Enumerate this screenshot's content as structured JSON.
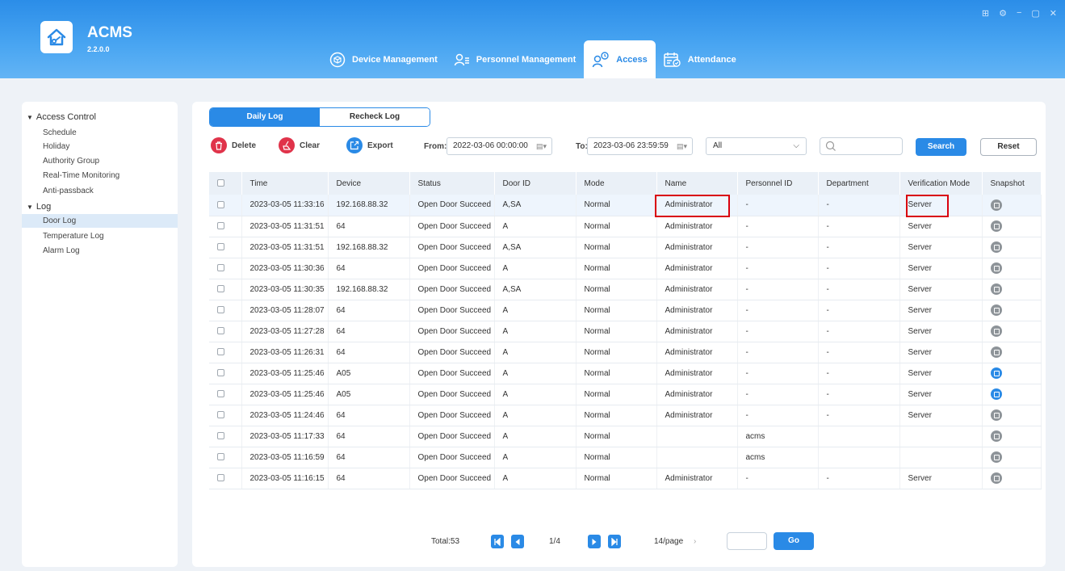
{
  "app": {
    "title": "ACMS",
    "version": "2.2.0.0"
  },
  "window_controls": [
    "⊞",
    "⚙",
    "−",
    "▢",
    "✕"
  ],
  "nav": [
    {
      "label": "Device Management",
      "icon": "device-icon"
    },
    {
      "label": "Personnel Management",
      "icon": "personnel-icon"
    },
    {
      "label": "Access",
      "icon": "access-icon",
      "active": true
    },
    {
      "label": "Attendance",
      "icon": "attendance-icon"
    }
  ],
  "sidebar": {
    "groups": [
      {
        "label": "Access Control",
        "children": [
          "Schedule",
          "Holiday",
          "Authority Group",
          "Real-Time Monitoring",
          "Anti-passback"
        ]
      },
      {
        "label": "Log",
        "children": [
          "Door Log",
          "Temperature Log",
          "Alarm Log"
        ]
      }
    ],
    "active": "Door Log"
  },
  "tabs": {
    "daily": "Daily Log",
    "recheck": "Recheck Log"
  },
  "toolbar": {
    "delete": "Delete",
    "clear": "Clear",
    "export": "Export",
    "from_label": "From:",
    "from_value": "2022-03-06 00:00:00",
    "to_label": "To:",
    "to_value": "2023-03-06 23:59:59",
    "filter_value": "All",
    "search_value": "",
    "search": "Search",
    "reset": "Reset"
  },
  "table": {
    "headers": [
      "Time",
      "Device",
      "Status",
      "Door ID",
      "Mode",
      "Name",
      "Personnel ID",
      "Department",
      "Verification Mode",
      "Snapshot"
    ],
    "rows": [
      [
        "2023-03-05 11:33:16",
        "192.168.88.32",
        "Open Door Succeed",
        "A,SA",
        "Normal",
        "Administrator",
        "-",
        "-",
        "Server",
        "gray"
      ],
      [
        "2023-03-05 11:31:51",
        "64",
        "Open Door Succeed",
        "A",
        "Normal",
        "Administrator",
        "-",
        "-",
        "Server",
        "gray"
      ],
      [
        "2023-03-05 11:31:51",
        "192.168.88.32",
        "Open Door Succeed",
        "A,SA",
        "Normal",
        "Administrator",
        "-",
        "-",
        "Server",
        "gray"
      ],
      [
        "2023-03-05 11:30:36",
        "64",
        "Open Door Succeed",
        "A",
        "Normal",
        "Administrator",
        "-",
        "-",
        "Server",
        "gray"
      ],
      [
        "2023-03-05 11:30:35",
        "192.168.88.32",
        "Open Door Succeed",
        "A,SA",
        "Normal",
        "Administrator",
        "-",
        "-",
        "Server",
        "gray"
      ],
      [
        "2023-03-05 11:28:07",
        "64",
        "Open Door Succeed",
        "A",
        "Normal",
        "Administrator",
        "-",
        "-",
        "Server",
        "gray"
      ],
      [
        "2023-03-05 11:27:28",
        "64",
        "Open Door Succeed",
        "A",
        "Normal",
        "Administrator",
        "-",
        "-",
        "Server",
        "gray"
      ],
      [
        "2023-03-05 11:26:31",
        "64",
        "Open Door Succeed",
        "A",
        "Normal",
        "Administrator",
        "-",
        "-",
        "Server",
        "gray"
      ],
      [
        "2023-03-05 11:25:46",
        "A05",
        "Open Door Succeed",
        "A",
        "Normal",
        "Administrator",
        "-",
        "-",
        "Server",
        "blue"
      ],
      [
        "2023-03-05 11:25:46",
        "A05",
        "Open Door Succeed",
        "A",
        "Normal",
        "Administrator",
        "-",
        "-",
        "Server",
        "blue"
      ],
      [
        "2023-03-05 11:24:46",
        "64",
        "Open Door Succeed",
        "A",
        "Normal",
        "Administrator",
        "-",
        "-",
        "Server",
        "gray"
      ],
      [
        "2023-03-05 11:17:33",
        "64",
        "Open Door Succeed",
        "A",
        "Normal",
        "",
        "acms",
        "",
        "",
        "gray"
      ],
      [
        "2023-03-05 11:16:59",
        "64",
        "Open Door Succeed",
        "A",
        "Normal",
        "",
        "acms",
        "",
        "",
        "gray"
      ],
      [
        "2023-03-05 11:16:15",
        "64",
        "Open Door Succeed",
        "A",
        "Normal",
        "Administrator",
        "-",
        "-",
        "Server",
        "gray"
      ]
    ]
  },
  "pagination": {
    "total": "Total:53",
    "page": "1/4",
    "per_page": "14/page",
    "per_page_arrow": "›",
    "go": "Go"
  },
  "colors": {
    "accent": "#2a8ae6",
    "danger": "#e0334a",
    "highlight": "#d9000d",
    "snapshot_gray": "#8e9499"
  }
}
